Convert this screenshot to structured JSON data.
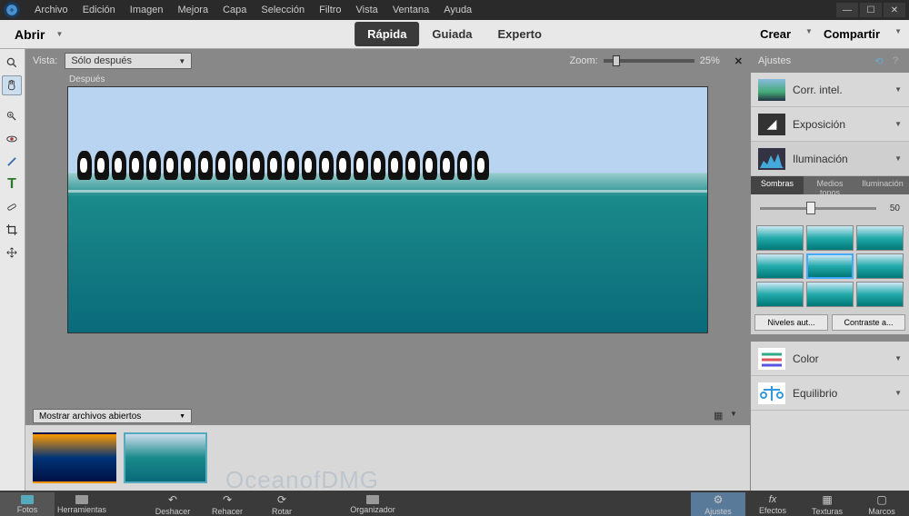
{
  "menubar": [
    "Archivo",
    "Edición",
    "Imagen",
    "Mejora",
    "Capa",
    "Selección",
    "Filtro",
    "Vista",
    "Ventana",
    "Ayuda"
  ],
  "modebar": {
    "open": "Abrir",
    "tabs": [
      "Rápida",
      "Guiada",
      "Experto"
    ],
    "active_tab": 0,
    "create": "Crear",
    "share": "Compartir"
  },
  "viewbar": {
    "vista_label": "Vista:",
    "vista_value": "Sólo después",
    "zoom_label": "Zoom:",
    "zoom_value": "25%"
  },
  "canvas": {
    "label": "Después"
  },
  "filebar": {
    "select": "Mostrar archivos abiertos"
  },
  "watermark": "OceanofDMG",
  "bottom_tabs": [
    "Fotos",
    "Herramientas",
    "Deshacer",
    "Rehacer",
    "Rotar",
    "Organizador"
  ],
  "right_panel": {
    "title": "Ajustes",
    "rows": [
      {
        "label": "Corr. intel.",
        "icon": "auto"
      },
      {
        "label": "Exposición",
        "icon": "exposure"
      },
      {
        "label": "Iluminación",
        "icon": "light"
      },
      {
        "label": "Color",
        "icon": "color"
      },
      {
        "label": "Equilibrio",
        "icon": "balance"
      }
    ],
    "subtabs": [
      "Sombras",
      "Medios tonos",
      "Iluminación"
    ],
    "active_subtab": 0,
    "slider_value": "50",
    "buttons": [
      "Niveles aut...",
      "Contraste a..."
    ]
  },
  "right_bottom_tabs": [
    "Ajustes",
    "Efectos",
    "Texturas",
    "Marcos"
  ]
}
